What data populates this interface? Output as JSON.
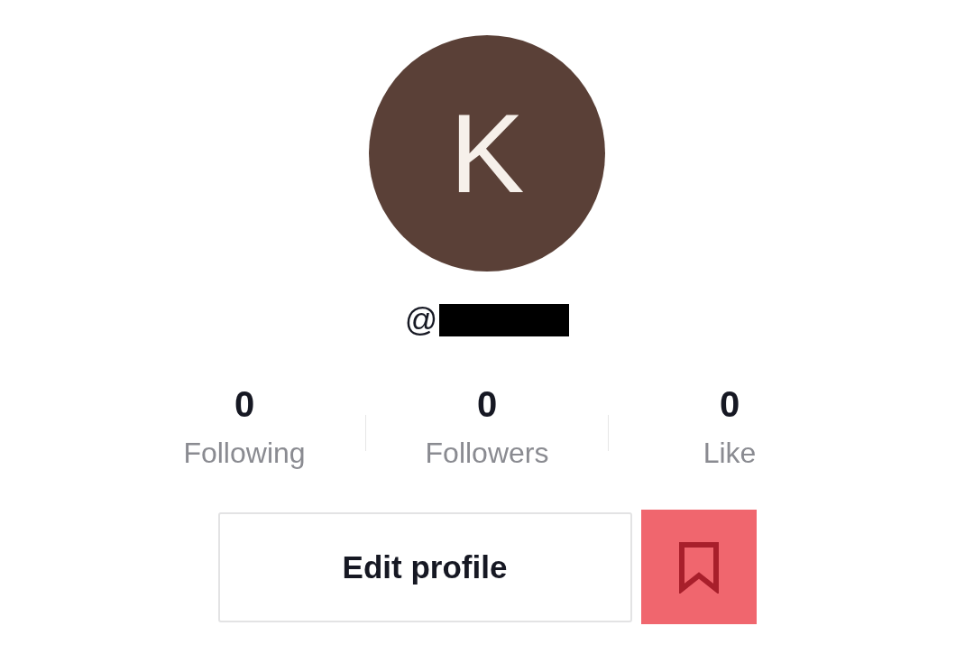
{
  "profile": {
    "avatar_letter": "K",
    "username_prefix": "@",
    "username_redacted": true
  },
  "stats": [
    {
      "value": "0",
      "label": "Following"
    },
    {
      "value": "0",
      "label": "Followers"
    },
    {
      "value": "0",
      "label": "Like"
    }
  ],
  "buttons": {
    "edit": "Edit profile",
    "bookmark_active": true
  }
}
